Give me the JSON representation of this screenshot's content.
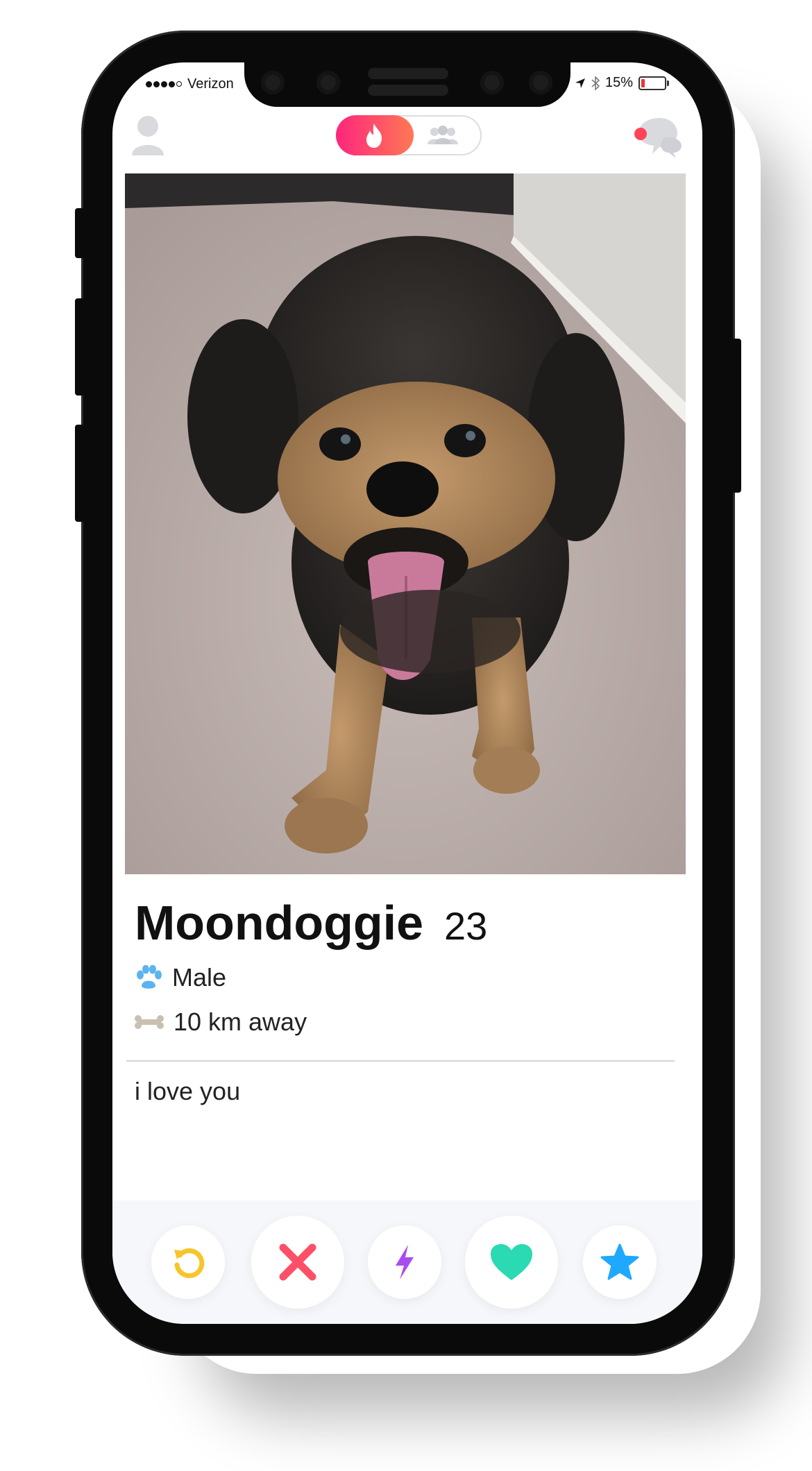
{
  "status_bar": {
    "carrier": "Verizon",
    "battery": "15%",
    "battery_level": 0.15
  },
  "profile": {
    "name": "Moondoggie",
    "age": "23",
    "gender": "Male",
    "distance": "10 km away",
    "bio": "i love you"
  },
  "colors": {
    "brand_gradient_start": "#fd267d",
    "brand_gradient_end": "#ff7854",
    "rewind": "#f7c52b",
    "nope": "#fd5068",
    "boost": "#a84cf0",
    "like": "#2bd9b3",
    "super_like": "#1fa8ff",
    "paw_icon": "#5bb4ef",
    "bone_icon": "#c9c0b2"
  },
  "icons": {
    "profile": "user-icon",
    "discover": "flame-icon",
    "social": "group-icon",
    "messages": "chat-icon",
    "gender": "paw-icon",
    "distance": "bone-icon",
    "rewind": "rewind-icon",
    "nope": "x-icon",
    "boost": "lightning-icon",
    "like": "heart-icon",
    "super_like": "star-icon"
  }
}
